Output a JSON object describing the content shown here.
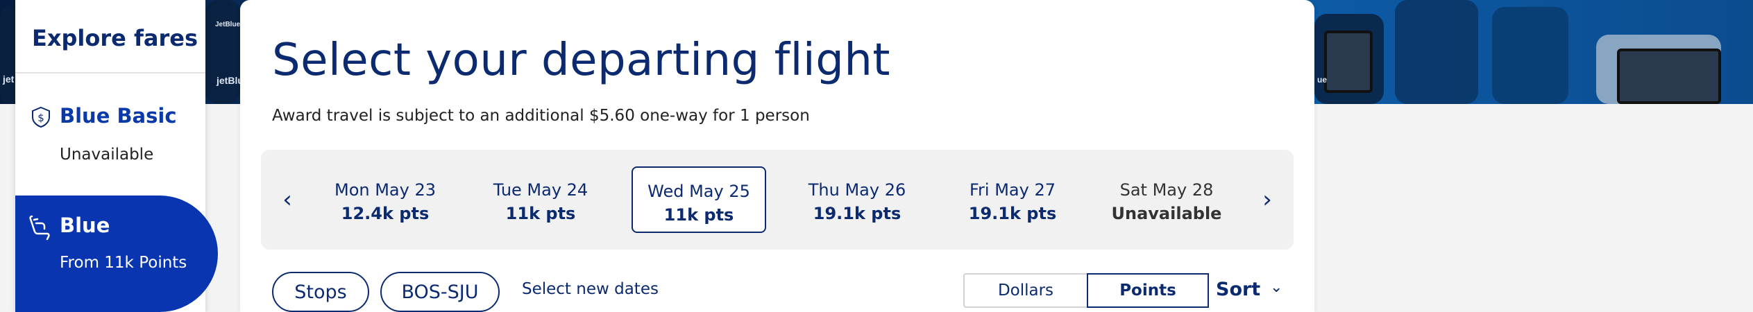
{
  "sidebar": {
    "title": "Explore fares",
    "fares": [
      {
        "name": "Blue Basic",
        "status": "Unavailable",
        "icon": "dollar-shield-icon",
        "selected": false
      },
      {
        "name": "Blue",
        "status": "From 11k Points",
        "icon": "seat-icon",
        "selected": true
      }
    ]
  },
  "header": {
    "title": "Select your departing flight",
    "note": "Award travel is subject to an additional $5.60 one-way for 1 person"
  },
  "dates": {
    "prev_icon": "chevron-left-icon",
    "next_icon": "chevron-right-icon",
    "items": [
      {
        "label": "Mon May 23",
        "value": "12.4k pts",
        "selected": false,
        "available": true
      },
      {
        "label": "Tue May 24",
        "value": "11k pts",
        "selected": false,
        "available": true
      },
      {
        "label": "Wed May 25",
        "value": "11k pts",
        "selected": true,
        "available": true
      },
      {
        "label": "Thu May 26",
        "value": "19.1k pts",
        "selected": false,
        "available": true
      },
      {
        "label": "Fri May 27",
        "value": "19.1k pts",
        "selected": false,
        "available": true
      },
      {
        "label": "Sat May 28",
        "value": "Unavailable",
        "selected": false,
        "available": false
      }
    ]
  },
  "filters": {
    "stops_label": "Stops",
    "route_label": "BOS-SJU",
    "new_dates_label": "Select new dates"
  },
  "currency_toggle": {
    "options": [
      "Dollars",
      "Points"
    ],
    "active": "Points"
  },
  "sort": {
    "label": "Sort",
    "icon": "chevron-down-icon"
  },
  "colors": {
    "brand_navy": "#0b2a6f",
    "brand_blue": "#0a35b0",
    "blue_text": "#0a3aa9"
  }
}
